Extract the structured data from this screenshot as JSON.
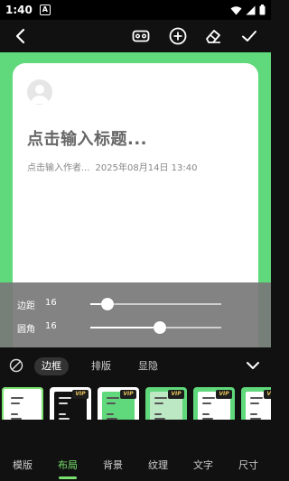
{
  "status_bar": {
    "time": "1:40",
    "notification_badge": "A"
  },
  "toolbar": {
    "icons": [
      "back-arrow-icon",
      "vr-goggles-icon",
      "add-circle-icon",
      "eraser-icon",
      "check-icon"
    ]
  },
  "card": {
    "title_placeholder": "点击输入标题...",
    "author_placeholder": "点击输入作者...",
    "date": "2025年08月14日 13:40"
  },
  "sliders": [
    {
      "label": "边距",
      "value": "16",
      "fraction": 0.13
    },
    {
      "label": "圆角",
      "value": "16",
      "fraction": 0.53
    }
  ],
  "subtabs": {
    "items": [
      "边框",
      "排版",
      "显隐"
    ],
    "active_index": 0
  },
  "templates": {
    "vip_label": "VIP",
    "items": [
      {
        "bg": "#ffffff",
        "inner": "#ffffff",
        "vip": false,
        "selected": true
      },
      {
        "bg": "#ffffff",
        "inner": "#111111",
        "vip": true,
        "selected": false
      },
      {
        "bg": "#ffffff",
        "inner": "#5fd97b",
        "vip": true,
        "selected": false
      },
      {
        "bg": "#5fd97b",
        "inner": "#bde8c4",
        "vip": true,
        "selected": false
      },
      {
        "bg": "#5fd97b",
        "inner": "#ffffff",
        "vip": true,
        "selected": false
      },
      {
        "bg": "#5fd97b",
        "inner": "#ffffff",
        "vip": true,
        "selected": false
      }
    ]
  },
  "bottom_nav": {
    "items": [
      "模版",
      "布局",
      "背景",
      "纹理",
      "文字",
      "尺寸"
    ],
    "active_index": 1
  },
  "colors": {
    "accent": "#7be36f",
    "canvas_green": "#5fd97b"
  }
}
